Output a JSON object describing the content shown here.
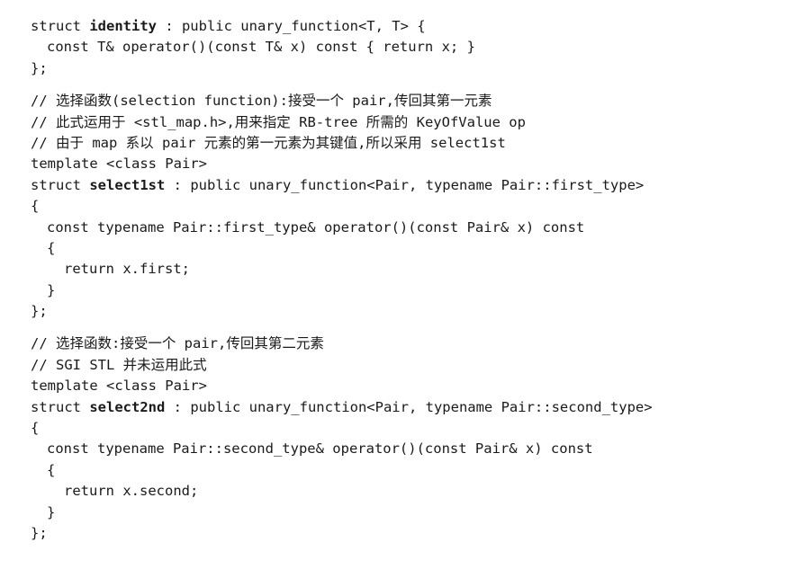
{
  "code": {
    "l1_pre": "struct ",
    "l1_bold": "identity",
    "l1_post": " : public unary_function<T, T> {",
    "l2": "const T& operator()(const T& x) const { return x; }",
    "l3": "};",
    "l4": "// 选择函数(selection function):接受一个 pair,传回其第一元素",
    "l5": "// 此式运用于 <stl_map.h>,用来指定 RB-tree 所需的 KeyOfValue op",
    "l6": "// 由于 map 系以 pair 元素的第一元素为其键值,所以采用 select1st",
    "l7": "template <class Pair>",
    "l8_pre": "struct ",
    "l8_bold": "select1st",
    "l8_post": " : public unary_function<Pair, typename Pair::first_type>",
    "l9": "{",
    "l10": "const typename Pair::first_type& operator()(const Pair& x) const",
    "l11": "{",
    "l12": "return x.first;",
    "l13": "}",
    "l14": "};",
    "l15": "// 选择函数:接受一个 pair,传回其第二元素",
    "l16": "// SGI STL 并未运用此式",
    "l17": "template <class Pair>",
    "l18_pre": "struct ",
    "l18_bold": "select2nd",
    "l18_post": " : public unary_function<Pair, typename Pair::second_type>",
    "l19": "{",
    "l20": "const typename Pair::second_type& operator()(const Pair& x) const",
    "l21": "{",
    "l22": "return x.second;",
    "l23": "}",
    "l24": "};"
  }
}
